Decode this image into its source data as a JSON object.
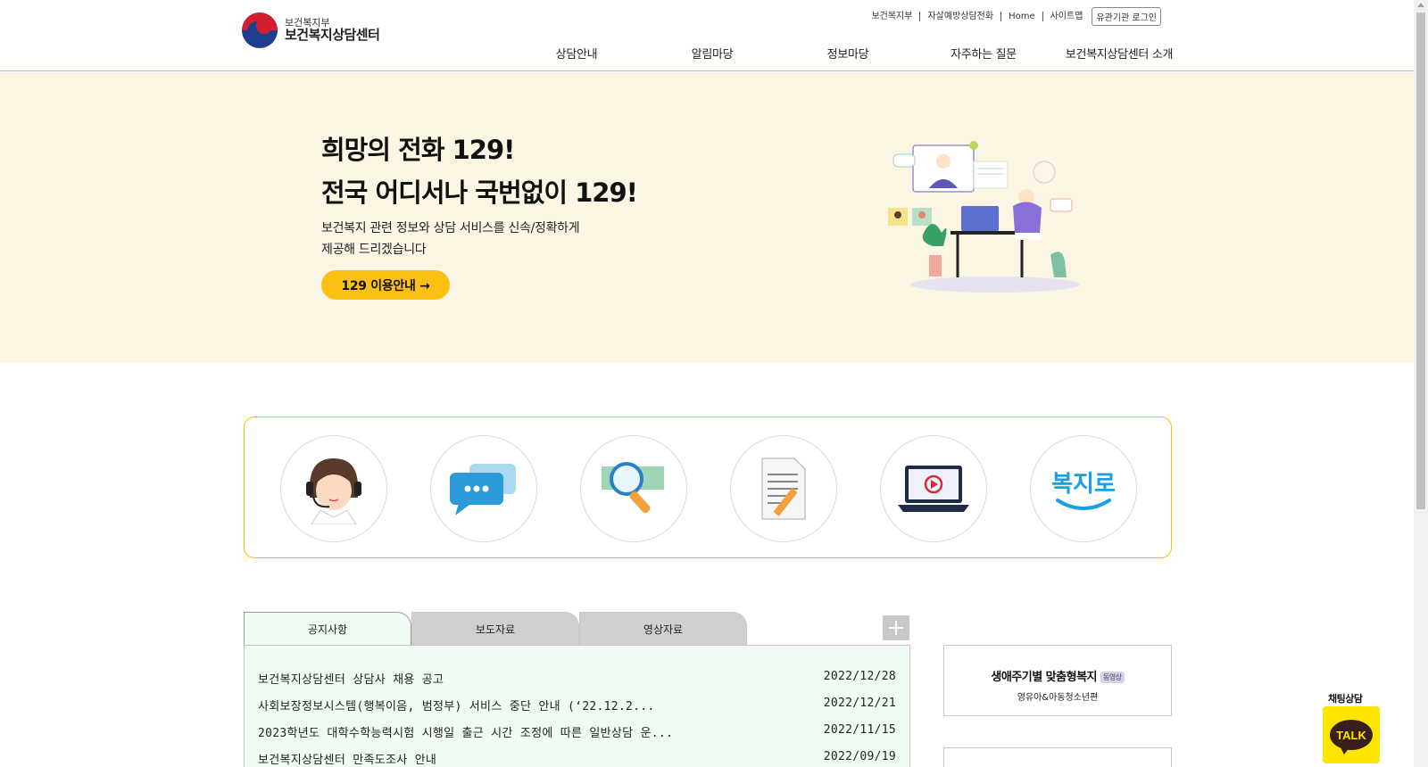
{
  "header": {
    "logo": {
      "small": "보건복지부",
      "big": "보건복지상담센터"
    },
    "util_links": [
      "보건복지부",
      "자살예방상담전화",
      "Home",
      "사이트맵"
    ],
    "login_label": "유관기관 로그인",
    "gnb": [
      "상담안내",
      "알림마당",
      "정보마당",
      "자주하는 질문",
      "보건복지상담센터 소개"
    ]
  },
  "hero": {
    "title_line1": "희망의 전화 129!",
    "title_line2": "전국 어디서나 국번없이 129!",
    "desc_line1": "보건복지 관련 정보와 상담 서비스를 신속/정확하게",
    "desc_line2": "제공해 드리겠습니다",
    "button_label": "129 이용안내 →"
  },
  "quick_menu": {
    "icons": [
      "counselor-icon",
      "chat-bubbles-icon",
      "search-magnifier-icon",
      "document-icon",
      "video-play-icon"
    ],
    "bokjiro_text": "복지로",
    "colors": {
      "border": "#f4c300",
      "bokjiro": "#1aa0e0"
    }
  },
  "board": {
    "tabs": [
      "공지사항",
      "보도자료",
      "영상자료"
    ],
    "active_tab": "공지사항",
    "rows": [
      {
        "title": "보건복지상담센터 상담사 채용 공고",
        "date": "2022/12/28"
      },
      {
        "title": "사회보장정보시스템(행복이음, 범정부) 서비스 중단 안내 (‘22.12.2...",
        "date": "2022/12/21"
      },
      {
        "title": "2023학년도 대학수학능력시험 시행일 출근 시간 조정에 따른 일반상담 운...",
        "date": "2022/11/15"
      },
      {
        "title": "보건복지상담센터 만족도조사 안내",
        "date": "2022/09/19"
      }
    ]
  },
  "side": {
    "title": "생애주기별 맞춤형복지",
    "badge": "동영상",
    "sub": "영유아&아동청소년편"
  },
  "chat": {
    "label": "채팅상담",
    "talk": "TALK",
    "color": "#fee500"
  },
  "colors": {
    "accent": "#fbc016",
    "hero_bg": "#fbf6e4",
    "board_bg": "#f0fbf4"
  }
}
